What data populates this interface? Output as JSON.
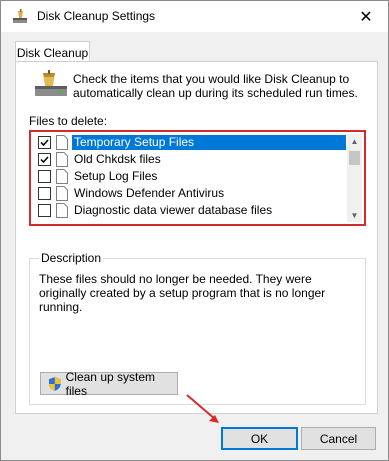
{
  "window": {
    "title": "Disk Cleanup Settings",
    "close_glyph": "✕"
  },
  "tabs": [
    {
      "label": "Disk Cleanup"
    }
  ],
  "intro_text": "Check the items that you would like Disk Cleanup to automatically clean up during its scheduled run times.",
  "files_label": "Files to delete:",
  "files": [
    {
      "label": "Temporary Setup Files",
      "checked": true,
      "selected": true
    },
    {
      "label": "Old Chkdsk files",
      "checked": true,
      "selected": false
    },
    {
      "label": "Setup Log Files",
      "checked": false,
      "selected": false
    },
    {
      "label": "Windows Defender Antivirus",
      "checked": false,
      "selected": false
    },
    {
      "label": "Diagnostic data viewer database files",
      "checked": false,
      "selected": false
    }
  ],
  "description": {
    "title": "Description",
    "text": "These files should no longer be needed. They were originally created by a setup program that is no longer running."
  },
  "cleanup_system_button": "Clean up system files",
  "ok_label": "OK",
  "cancel_label": "Cancel",
  "colors": {
    "selection": "#0078d7",
    "highlight_outline": "#d62b2b",
    "annotation_arrow": "#d62b2b"
  }
}
